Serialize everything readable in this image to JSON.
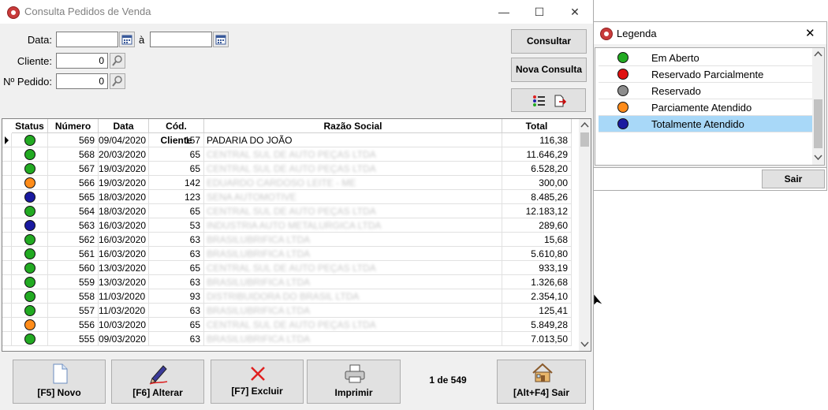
{
  "main": {
    "title": "Consulta Pedidos de Venda",
    "window_controls": {
      "minimize": "—",
      "maximize": "☐",
      "close": "✕"
    },
    "form": {
      "data_label": "Data:",
      "data_from": "",
      "to_label": "à",
      "data_to": "",
      "cliente_label": "Cliente:",
      "cliente_value": "0",
      "pedido_label": "Nº Pedido:",
      "pedido_value": "0"
    },
    "buttons": {
      "consultar": "Consultar",
      "nova_consulta": "Nova Consulta"
    },
    "grid": {
      "columns": [
        "Status",
        "Número",
        "Data",
        "Cód. Cliente",
        "Razão Social",
        "Total"
      ],
      "rows": [
        {
          "status": "#22aa22",
          "numero": "569",
          "data": "09/04/2020",
          "cod": "157",
          "razao": "PADARIA DO JOÃO",
          "blur": false,
          "total": "116,38"
        },
        {
          "status": "#22aa22",
          "numero": "568",
          "data": "20/03/2020",
          "cod": "65",
          "razao": "CENTRAL SUL DE AUTO PEÇAS LTDA",
          "blur": true,
          "total": "11.646,29"
        },
        {
          "status": "#22aa22",
          "numero": "567",
          "data": "19/03/2020",
          "cod": "65",
          "razao": "CENTRAL SUL DE AUTO PEÇAS LTDA",
          "blur": true,
          "total": "6.528,20"
        },
        {
          "status": "#ff8c1a",
          "numero": "566",
          "data": "19/03/2020",
          "cod": "142",
          "razao": "EDUARDO CARDOSO LEITE - ME",
          "blur": true,
          "total": "300,00"
        },
        {
          "status": "#1a1aa0",
          "numero": "565",
          "data": "18/03/2020",
          "cod": "123",
          "razao": "SENA AUTOMOTIVE",
          "blur": true,
          "total": "8.485,26"
        },
        {
          "status": "#22aa22",
          "numero": "564",
          "data": "18/03/2020",
          "cod": "65",
          "razao": "CENTRAL SUL DE AUTO PEÇAS LTDA",
          "blur": true,
          "total": "12.183,12"
        },
        {
          "status": "#1a1aa0",
          "numero": "563",
          "data": "16/03/2020",
          "cod": "53",
          "razao": "INDUSTRIA AUTO METALURGICA LTDA",
          "blur": true,
          "total": "289,60"
        },
        {
          "status": "#22aa22",
          "numero": "562",
          "data": "16/03/2020",
          "cod": "63",
          "razao": "BRASILUBRIFICA LTDA",
          "blur": true,
          "total": "15,68"
        },
        {
          "status": "#22aa22",
          "numero": "561",
          "data": "16/03/2020",
          "cod": "63",
          "razao": "BRASILUBRIFICA LTDA",
          "blur": true,
          "total": "5.610,80"
        },
        {
          "status": "#22aa22",
          "numero": "560",
          "data": "13/03/2020",
          "cod": "65",
          "razao": "CENTRAL SUL DE AUTO PEÇAS LTDA",
          "blur": true,
          "total": "933,19"
        },
        {
          "status": "#22aa22",
          "numero": "559",
          "data": "13/03/2020",
          "cod": "63",
          "razao": "BRASILUBRIFICA LTDA",
          "blur": true,
          "total": "1.326,68"
        },
        {
          "status": "#22aa22",
          "numero": "558",
          "data": "11/03/2020",
          "cod": "93",
          "razao": "DISTRIBUIDORA DO BRASIL LTDA",
          "blur": true,
          "total": "2.354,10"
        },
        {
          "status": "#22aa22",
          "numero": "557",
          "data": "11/03/2020",
          "cod": "63",
          "razao": "BRASILUBRIFICA LTDA",
          "blur": true,
          "total": "125,41"
        },
        {
          "status": "#ff8c1a",
          "numero": "556",
          "data": "10/03/2020",
          "cod": "65",
          "razao": "CENTRAL SUL DE AUTO PEÇAS LTDA",
          "blur": true,
          "total": "5.849,28"
        },
        {
          "status": "#22aa22",
          "numero": "555",
          "data": "09/03/2020",
          "cod": "63",
          "razao": "BRASILUBRIFICA LTDA",
          "blur": true,
          "total": "7.013,50"
        }
      ]
    },
    "bottom": {
      "novo": "[F5] Novo",
      "alterar": "[F6] Alterar",
      "excluir": "[F7] Excluir",
      "imprimir": "Imprimir",
      "page_info": "1 de 549",
      "sair": "[Alt+F4] Sair"
    }
  },
  "legend": {
    "title": "Legenda",
    "close": "✕",
    "items": [
      {
        "label": "Em Aberto",
        "color": "#22aa22"
      },
      {
        "label": "Reservado Parcialmente",
        "color": "#e01010"
      },
      {
        "label": "Reservado",
        "color": "#8c8c8c"
      },
      {
        "label": "Parciamente Atendido",
        "color": "#ff8c1a"
      },
      {
        "label": "Totalmente Atendido",
        "color": "#1a1aa0"
      }
    ],
    "sair": "Sair"
  }
}
